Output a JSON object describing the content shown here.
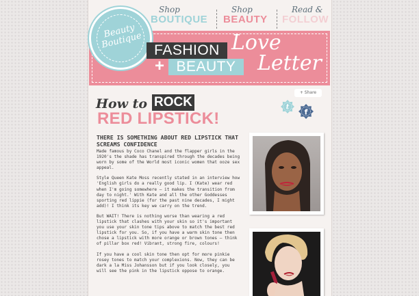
{
  "nav": {
    "items": [
      {
        "script": "Shop",
        "big": "BOUTIQUE",
        "color": "#9fd3d8"
      },
      {
        "script": "Shop",
        "big": "BEAUTY",
        "color": "#ec8d9a"
      },
      {
        "script": "Read &",
        "big": "FOLLOW",
        "color": "#f3cfd3"
      }
    ]
  },
  "header": {
    "badge": "Beauty Boutique",
    "fashion": "FASHION",
    "plus": "+",
    "beauty": "BEAUTY",
    "love": "Love",
    "letter": "Letter"
  },
  "share": {
    "label": "Share",
    "icons": [
      "twitter-icon",
      "facebook-icon"
    ]
  },
  "article": {
    "how_to": "How to",
    "rock": "ROCK",
    "red_lipstick": "RED LIPSTICK!",
    "headline": "THERE IS SOMETHING ABOUT RED LIPSTICK THAT SCREAMS CONFIDENCE",
    "paragraphs": [
      "Made famous by Coco Chanel and the flapper girls in the 1920's the shade has transpired through the decades being worn by some of the World most iconic women that ooze sex appeal.",
      "Style Queen Kate Moss recently stated in an interview how 'English girls do a really good lip. I (Kate) wear red when I'm going somewhere – it makes the transition from day to night.' With Kate and all the other Goddesses sporting red lippie (for the past nine decades, I might add)! I think its key we carry on the trend.",
      "But WAIT! There is nothing worse than wearing a red lipstick that clashes with your skin so it's important you use your skin tone tips above to match the best red lipstick for you. So, if you have a warm skin tone then chose a lipstick with more orange or brown tones – think of pillar box red! Vibrant, strong fire, colours!",
      "If you have a cool skin tone then opt for more pinkie rosey tones to match your complexions. Now, they can be dark a la Miss Johansson but if you look closely, you will see the pink in the lipstick oppose to orange."
    ]
  },
  "colors": {
    "pink": "#ec8d9a",
    "aqua": "#9fd3d8",
    "dark": "#3a3a3a",
    "paper": "#f6f2f0"
  }
}
